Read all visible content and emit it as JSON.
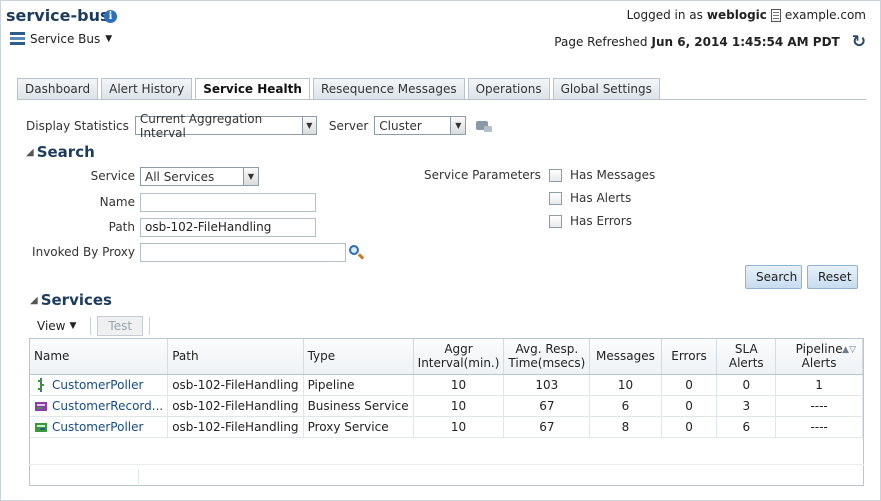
{
  "header": {
    "app_title": "service-bus",
    "logged_in_prefix": "Logged in as",
    "username": "weblogic",
    "domain": "example.com",
    "service_bus_menu": "Service Bus",
    "page_refreshed_label": "Page Refreshed",
    "page_refreshed_value": "Jun 6, 2014 1:45:54 AM PDT"
  },
  "tabs": [
    {
      "label": "Dashboard",
      "active": false
    },
    {
      "label": "Alert History",
      "active": false
    },
    {
      "label": "Service Health",
      "active": true
    },
    {
      "label": "Resequence Messages",
      "active": false
    },
    {
      "label": "Operations",
      "active": false
    },
    {
      "label": "Global Settings",
      "active": false
    }
  ],
  "stats": {
    "display_label": "Display Statistics",
    "display_value": "Current Aggregation Interval",
    "server_label": "Server",
    "server_value": "Cluster"
  },
  "search": {
    "title": "Search",
    "service_label": "Service",
    "service_value": "All Services",
    "name_label": "Name",
    "name_value": "",
    "path_label": "Path",
    "path_value": "osb-102-FileHandling",
    "invoked_label": "Invoked By Proxy",
    "invoked_value": "",
    "params_label": "Service Parameters",
    "has_messages": "Has Messages",
    "has_alerts": "Has Alerts",
    "has_errors": "Has Errors",
    "search_button": "Search",
    "reset_button": "Reset"
  },
  "services": {
    "title": "Services",
    "view_menu": "View",
    "test_button": "Test",
    "columns": {
      "name": "Name",
      "path": "Path",
      "type": "Type",
      "aggr": "Aggr Interval(min.)",
      "avg": "Avg. Resp. Time(msecs)",
      "messages": "Messages",
      "errors": "Errors",
      "sla": "SLA Alerts",
      "pipeline": "Pipeline Alerts"
    },
    "rows": [
      {
        "name": "CustomerPoller",
        "path": "osb-102-FileHandling",
        "type": "Pipeline",
        "aggr": "10",
        "avg": "103",
        "messages": "10",
        "errors": "0",
        "sla": "0",
        "pipeline": "1",
        "icon": "pipeline-icon"
      },
      {
        "name": "CustomerRecord...",
        "path": "osb-102-FileHandling",
        "type": "Business Service",
        "aggr": "10",
        "avg": "67",
        "messages": "6",
        "errors": "0",
        "sla": "3",
        "pipeline": "----",
        "icon": "business-service-icon"
      },
      {
        "name": "CustomerPoller",
        "path": "osb-102-FileHandling",
        "type": "Proxy Service",
        "aggr": "10",
        "avg": "67",
        "messages": "8",
        "errors": "0",
        "sla": "6",
        "pipeline": "----",
        "icon": "proxy-service-icon"
      }
    ]
  },
  "colors": {
    "title": "#1d3c5d",
    "link": "#164a85",
    "button": "#c8dcef"
  }
}
